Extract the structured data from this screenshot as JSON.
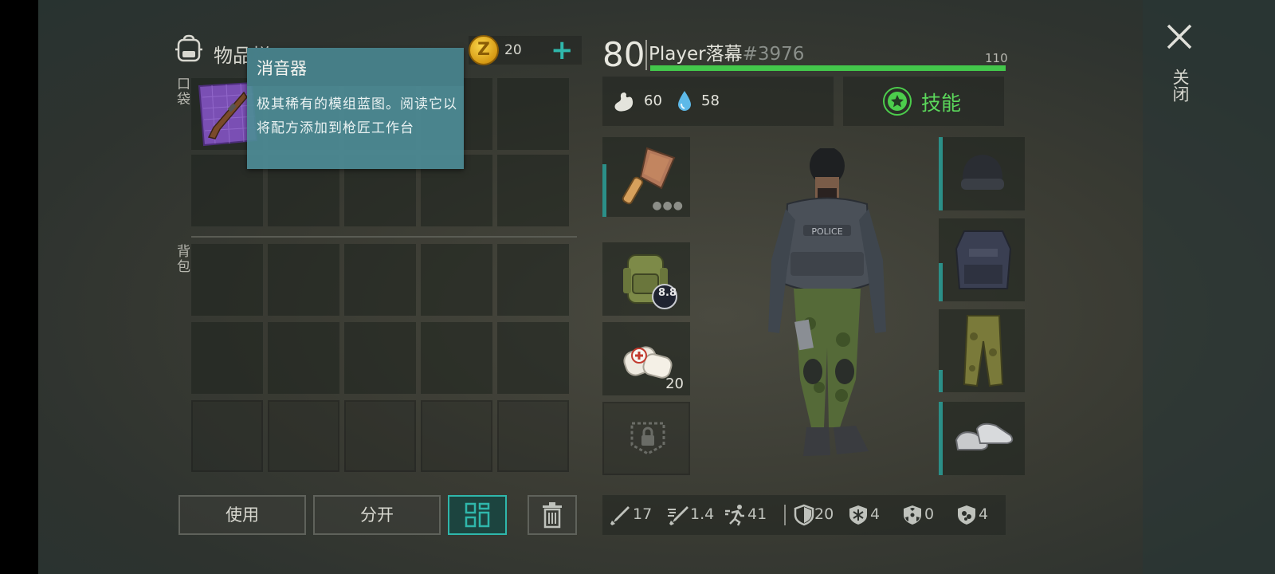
{
  "inventory": {
    "title": "物品栏",
    "coins": "20",
    "coin_symbol": "Z",
    "pocket_label": "口袋",
    "backpack_label": "背包"
  },
  "tooltip": {
    "title": "消音器",
    "description": "极其稀有的模组蓝图。阅读它以将配方添加到枪匠工作台"
  },
  "buttons": {
    "use": "使用",
    "split": "分开"
  },
  "player": {
    "level": "80",
    "name": "Player落幕",
    "tag": "#3976",
    "xp_next": "110",
    "xp_fraction": 1.0,
    "hunger": "60",
    "thirst": "58",
    "skills_label": "技能"
  },
  "equipment": {
    "bandage_count": "20",
    "backpack_badge": "8.8"
  },
  "bottom_stats": {
    "attack": "17",
    "attack_speed": "1.4",
    "move_speed": "41",
    "armor": "20",
    "cold_resist": "4",
    "radiation_resist": "0",
    "toxic_resist": "4"
  },
  "close_label": "关闭",
  "colors": {
    "accent": "#2fb7ab",
    "xp": "#43c74b",
    "skill": "#5bd85b",
    "tooltip": "#4d8c96"
  }
}
